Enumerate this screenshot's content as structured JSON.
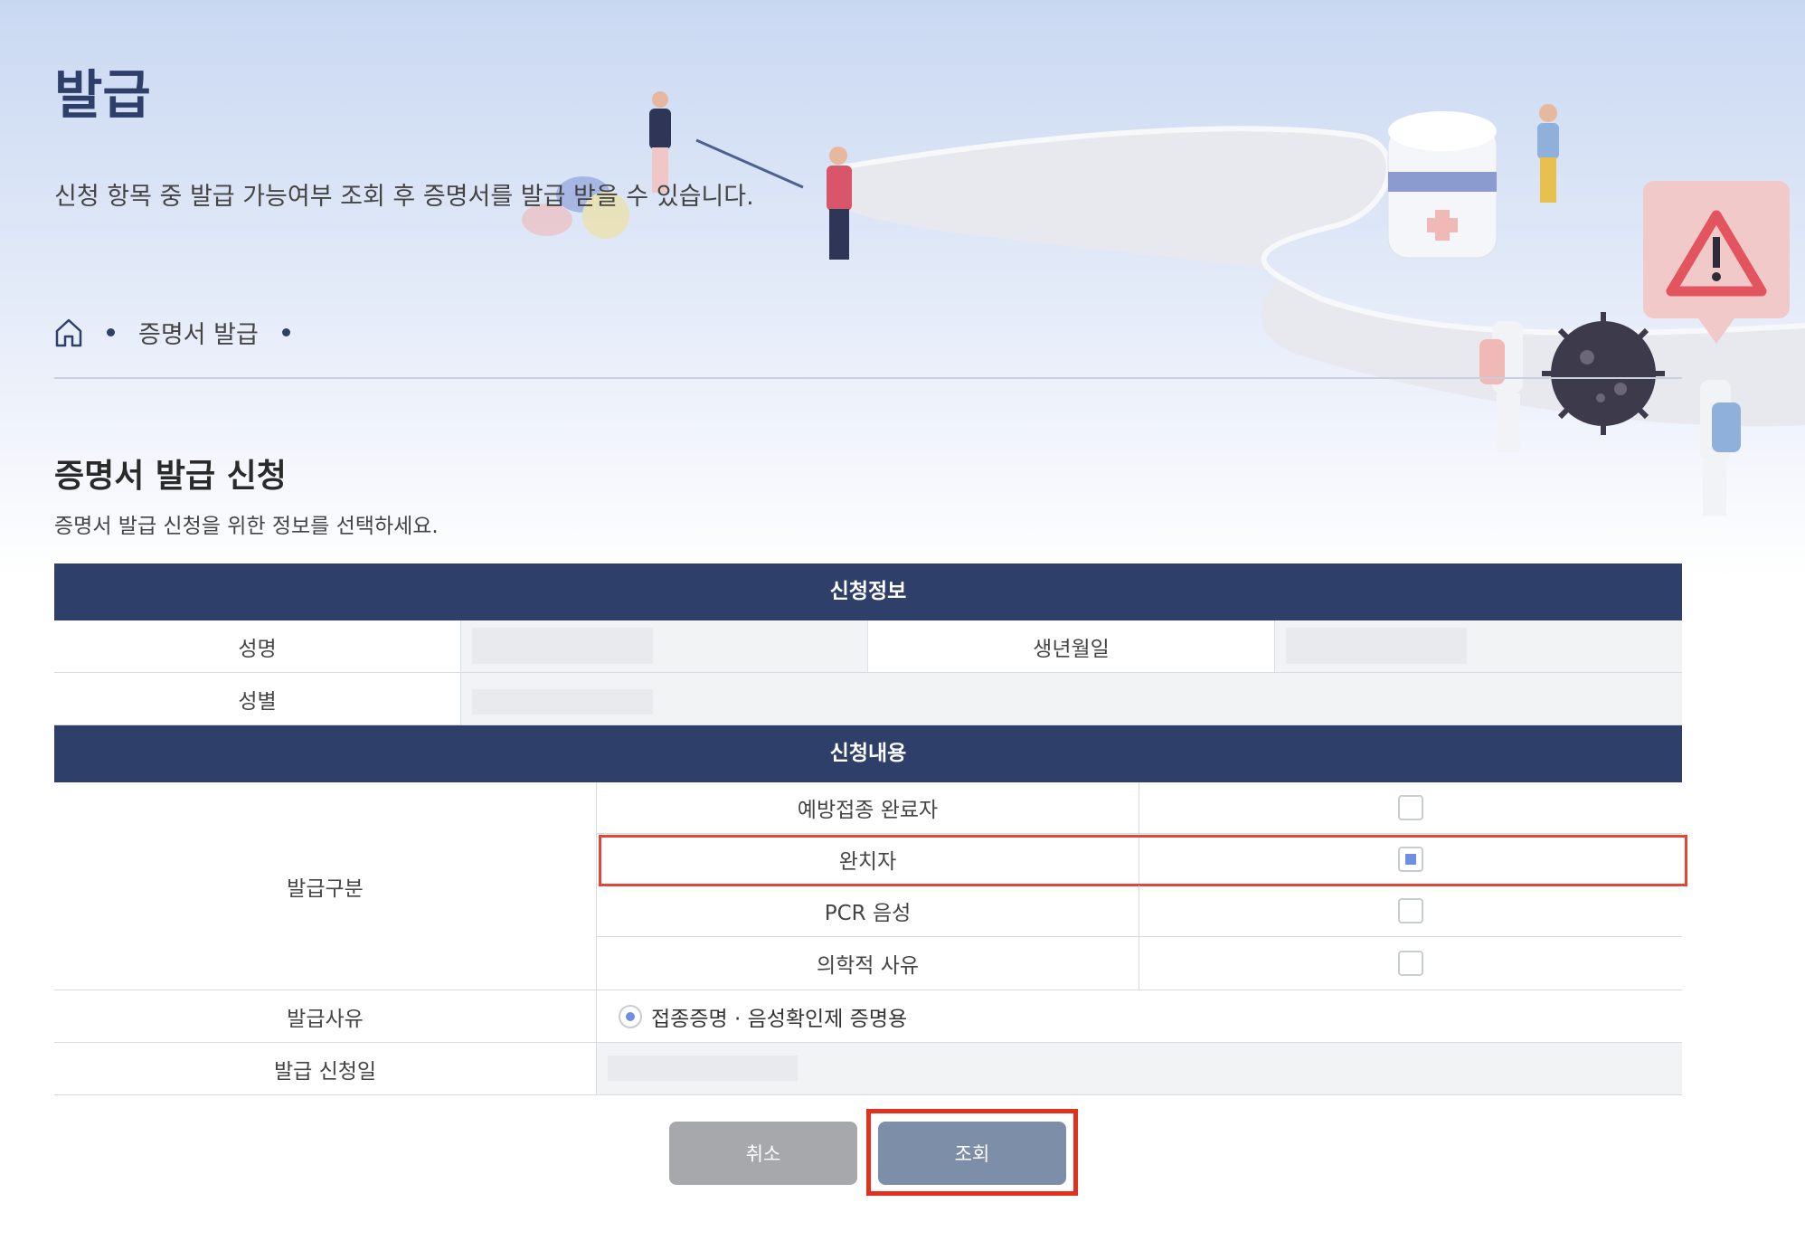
{
  "header": {
    "title": "발급",
    "description": "신청 항목 중 발급 가능여부 조회 후 증명서를 발급 받을 수 있습니다."
  },
  "breadcrumb": {
    "home_icon": "home-icon",
    "current": "증명서 발급"
  },
  "section": {
    "title": "증명서 발급 신청",
    "description": "증명서 발급 신청을 위한 정보를 선택하세요."
  },
  "applicant_info": {
    "band_title": "신청정보",
    "name_label": "성명",
    "birth_label": "생년월일",
    "gender_label": "성별"
  },
  "request_content": {
    "band_title": "신청내용",
    "issue_type_label": "발급구분",
    "options": [
      {
        "label": "예방접종 완료자",
        "checked": false
      },
      {
        "label": "완치자",
        "checked": true
      },
      {
        "label": "PCR 음성",
        "checked": false
      },
      {
        "label": "의학적 사유",
        "checked": false
      }
    ],
    "reason_label": "발급사유",
    "reason_value": "접종증명 · 음성확인제 증명용",
    "date_label": "발급 신청일"
  },
  "buttons": {
    "cancel": "취소",
    "search": "조회"
  },
  "colors": {
    "primary_navy": "#2e3f6a",
    "highlight_red": "#e2463a",
    "check_blue": "#6f8fe0",
    "button_gray": "#a7a8ab",
    "button_slate": "#7d8fa8"
  }
}
